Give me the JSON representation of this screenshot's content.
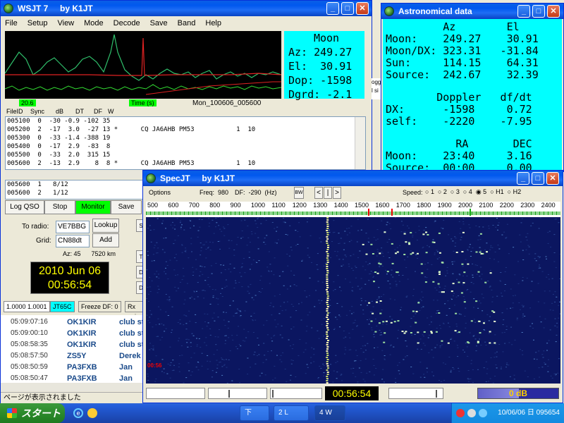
{
  "wsjt": {
    "title": "WSJT 7     by K1JT",
    "menu": [
      "File",
      "Setup",
      "View",
      "Mode",
      "Decode",
      "Save",
      "Band",
      "Help"
    ],
    "moon_panel": {
      "title": "Moon",
      "az": "Az: 249.27",
      "el": "El:  30.91",
      "dop": "Dop: -1598",
      "dgrd": "Dgrd: -2.1"
    },
    "plot_left_label": "20.6",
    "plot_mid_label": "Time (s)",
    "plot_file_label": "Mon_100606_005600",
    "decode_headers": [
      "FileID",
      "Sync",
      "dB",
      "DT",
      "DF",
      "W"
    ],
    "decode_lines": [
      "005100  0  -30 -0.9 -102 35",
      "005200  2  -17  3.0  -27 13 *      CQ JA6AHB PM53           1  10",
      "005300  0  -33 -1.4 -388 19",
      "005400  0  -17  2.9  -83  8",
      "005500  0  -33  2.0  315 15",
      "005600  2  -13  2.9    8  8 *      CQ JA6AHB PM53           1  10"
    ],
    "avg_lines": [
      "005600  1   8/12",
      "005600  2   1/12"
    ],
    "buttons": {
      "log_qso": "Log QSO",
      "stop": "Stop",
      "monitor": "Monitor",
      "save": "Save"
    },
    "to_radio_label": "To radio:",
    "to_radio_value": "VE7BBG",
    "grid_label": "Grid:",
    "grid_value": "CN88dt",
    "lookup": "Lookup",
    "add": "Add",
    "az_km": "Az: 45      7520 km",
    "clock_date": "2010 Jun 06",
    "clock_time": "00:56:54",
    "status": [
      "1.0000 1.0001",
      "JT65C",
      "Freeze DF:  0",
      "Rx noi"
    ],
    "log_rows": [
      {
        "time": "05:09:07:16",
        "call": "OK1KIR",
        "note": "club st"
      },
      {
        "time": "05:09:00:10",
        "call": "OK1KIR",
        "note": "club st"
      },
      {
        "time": "05:08:58:35",
        "call": "OK1KIR",
        "note": "club st"
      },
      {
        "time": "05:08:57:50",
        "call": "ZS5Y",
        "note": "Derek"
      },
      {
        "time": "05:08:50:59",
        "call": "PA3FXB",
        "note": "Jan"
      },
      {
        "time": "05:08:50:47",
        "call": "PA3FXB",
        "note": "Jan"
      }
    ],
    "statusbar": "ページが表示されました",
    "side_fragments": [
      "ogg",
      "l si"
    ]
  },
  "astro": {
    "title": "Astronomical data",
    "rows": [
      "         Az        El",
      "Moon:    249.27    30.91",
      "Moon/DX: 323.31   -31.84",
      "Sun:     114.15    64.31",
      "Source:  242.67    32.39",
      "",
      "        Doppler   df/dt",
      "DX:      -1598     0.72",
      "self:    -2220    -7.95",
      "",
      "           RA       DEC",
      "Moon:    23:40     3.16",
      "Source:  00:00     0.00"
    ]
  },
  "specjt": {
    "title": "SpecJT     by K1JT",
    "options": "Options",
    "freq": "Freq:  980",
    "df": "DF:  -290  (Hz)",
    "speed_label": "Speed:",
    "speeds": [
      "1",
      "2",
      "3",
      "4",
      "5",
      "H1",
      "H2"
    ],
    "speed_selected": "5",
    "scale": [
      "500",
      "600",
      "700",
      "800",
      "900",
      "1000",
      "1100",
      "1200",
      "1300",
      "1400",
      "1500",
      "1600",
      "1700",
      "1800",
      "1900",
      "2000",
      "2100",
      "2200",
      "2300",
      "2400"
    ],
    "wf_timestamp": "00:56",
    "bottom_time": "00:56:54",
    "bottom_db": "0 dB",
    "nav_buttons": [
      "BW",
      "<",
      "|",
      ">"
    ]
  },
  "taskbar": {
    "start": "スタート",
    "items": [
      "下",
      "2 L",
      "4 W"
    ],
    "clock": "10/06/06 日 095654"
  },
  "colors": {
    "xp_blue": "#0058ee",
    "moon_panel": "#00ffff",
    "monitor_green": "#00ff00",
    "clock_bg": "#000000",
    "clock_fg": "#ffff00",
    "waterfall": "#0b1660"
  }
}
